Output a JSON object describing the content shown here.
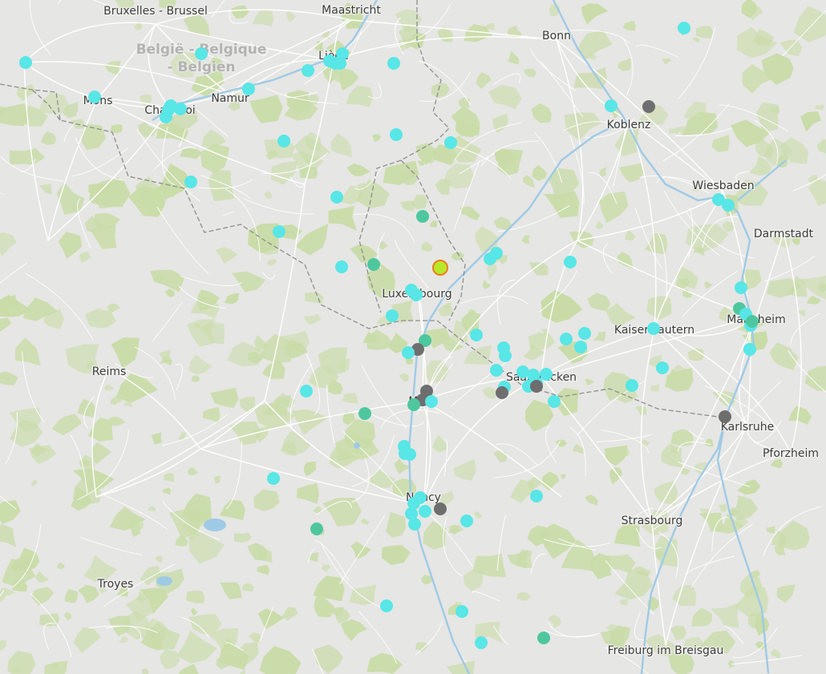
{
  "region_label": {
    "line1": "België - Belgique",
    "line2": "- Belgien"
  },
  "cities": [
    "Bruxelles - Brussel",
    "Maastricht",
    "Bonn",
    "Liège",
    "Namur",
    "Mons",
    "Charleroi",
    "Koblenz",
    "Wiesbaden",
    "Darmstadt",
    "Luxembourg",
    "Mannheim",
    "Kaiserslautern",
    "Reims",
    "Saarbrücken",
    "Metz",
    "Karlsruhe",
    "Pforzheim",
    "Nancy",
    "Strasbourg",
    "Troyes",
    "Freiburg im Breisgau"
  ],
  "marker_types": {
    "cyan": "#58e6e6",
    "teal": "#4ec79f",
    "gray": "#6e6e6e",
    "highlight": {
      "fill": "#b8e82a",
      "stroke": "#ef7b1e"
    }
  },
  "colors": {
    "background": "#e6e6e4",
    "forest": "#c9dca8",
    "road": "#ffffff",
    "river": "#9fcae6",
    "border": "#8e8e8e"
  }
}
